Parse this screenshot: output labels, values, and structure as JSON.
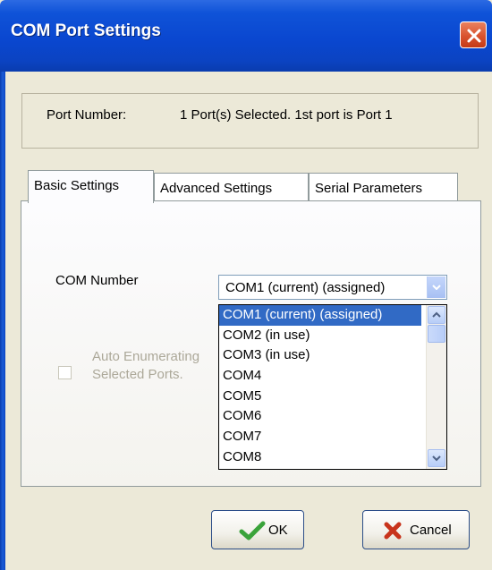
{
  "window": {
    "title": "COM Port Settings"
  },
  "port": {
    "label": "Port Number:",
    "value": "1 Port(s) Selected. 1st port is Port 1"
  },
  "tabs": [
    {
      "label": "Basic Settings",
      "active": true
    },
    {
      "label": "Advanced Settings",
      "active": false
    },
    {
      "label": "Serial Parameters",
      "active": false
    }
  ],
  "basic": {
    "com_label": "COM Number",
    "combo_value": "COM1 (current) (assigned)",
    "auto_line1": "Auto Enumerating",
    "auto_line2": "Selected Ports.",
    "auto_checked": false,
    "auto_enabled": false
  },
  "dropdown": {
    "items": [
      "COM1 (current) (assigned)",
      "COM2 (in use)",
      "COM3 (in use)",
      "COM4",
      "COM5",
      "COM6",
      "COM7",
      "COM8"
    ],
    "selected_index": 0
  },
  "buttons": {
    "ok": "OK",
    "cancel": "Cancel"
  },
  "icons": {
    "close": "close-icon",
    "combo_arrow": "chevron-down-icon",
    "scroll_up": "chevron-up-icon",
    "scroll_down": "chevron-down-icon",
    "ok": "checkmark-icon",
    "cancel": "x-icon"
  },
  "colors": {
    "title_bar": "#0a47d0",
    "close_button": "#d9532f",
    "dialog_bg": "#ece9d8",
    "selection": "#316ac5",
    "ok_check": "#3aa33a",
    "cancel_x": "#c8341c"
  }
}
